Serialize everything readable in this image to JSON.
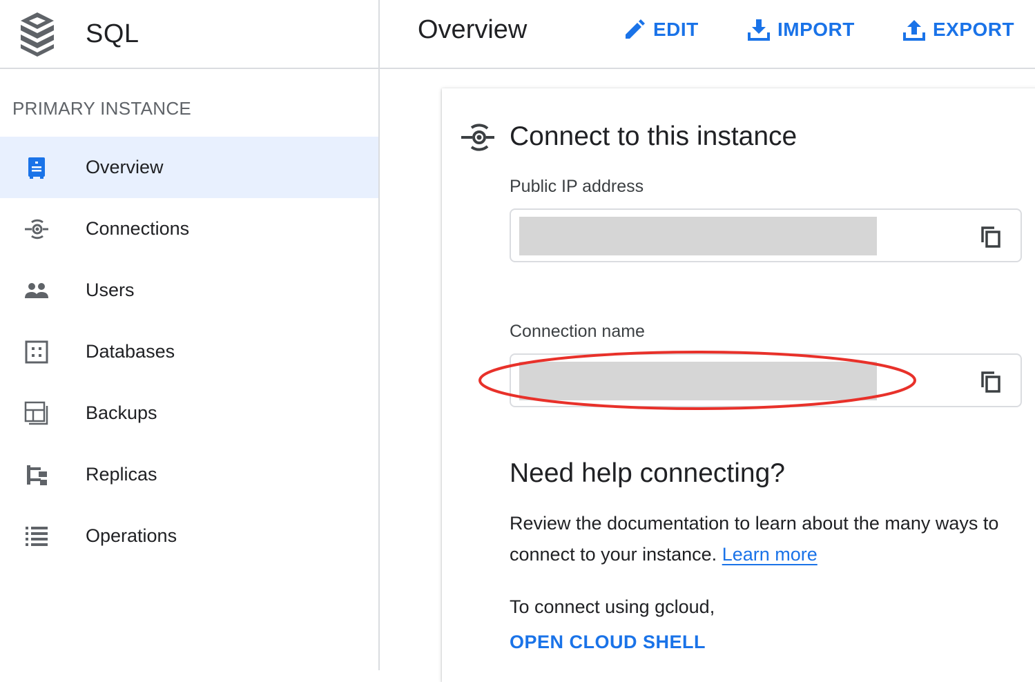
{
  "app": {
    "product_name": "SQL",
    "logo_icon": "cloud-sql-logo-icon"
  },
  "sidebar": {
    "section_label": "PRIMARY INSTANCE",
    "active_item": "Overview",
    "items": [
      {
        "label": "Overview",
        "icon": "overview-icon"
      },
      {
        "label": "Connections",
        "icon": "connections-icon"
      },
      {
        "label": "Users",
        "icon": "users-icon"
      },
      {
        "label": "Databases",
        "icon": "databases-icon"
      },
      {
        "label": "Backups",
        "icon": "backups-icon"
      },
      {
        "label": "Replicas",
        "icon": "replicas-icon"
      },
      {
        "label": "Operations",
        "icon": "operations-icon"
      }
    ]
  },
  "header": {
    "title": "Overview",
    "actions": {
      "edit": "EDIT",
      "import": "IMPORT",
      "export": "EXPORT"
    }
  },
  "connect": {
    "title": "Connect to this instance",
    "public_ip_label": "Public IP address",
    "public_ip_value": "",
    "connection_name_label": "Connection name",
    "connection_name_value": "",
    "copy_icon": "copy-icon"
  },
  "help": {
    "title": "Need help connecting?",
    "text": "Review the documentation to learn about the many ways to connect to your instance.",
    "learn_more": "Learn more",
    "gcloud_text": "To connect using gcloud,",
    "open_shell": "OPEN CLOUD SHELL"
  },
  "colors": {
    "accent": "#1a73e8",
    "active_bg": "#e8f0fe",
    "divider": "#dadce0",
    "annotation": "#e8312a",
    "redaction": "#d6d6d6"
  }
}
